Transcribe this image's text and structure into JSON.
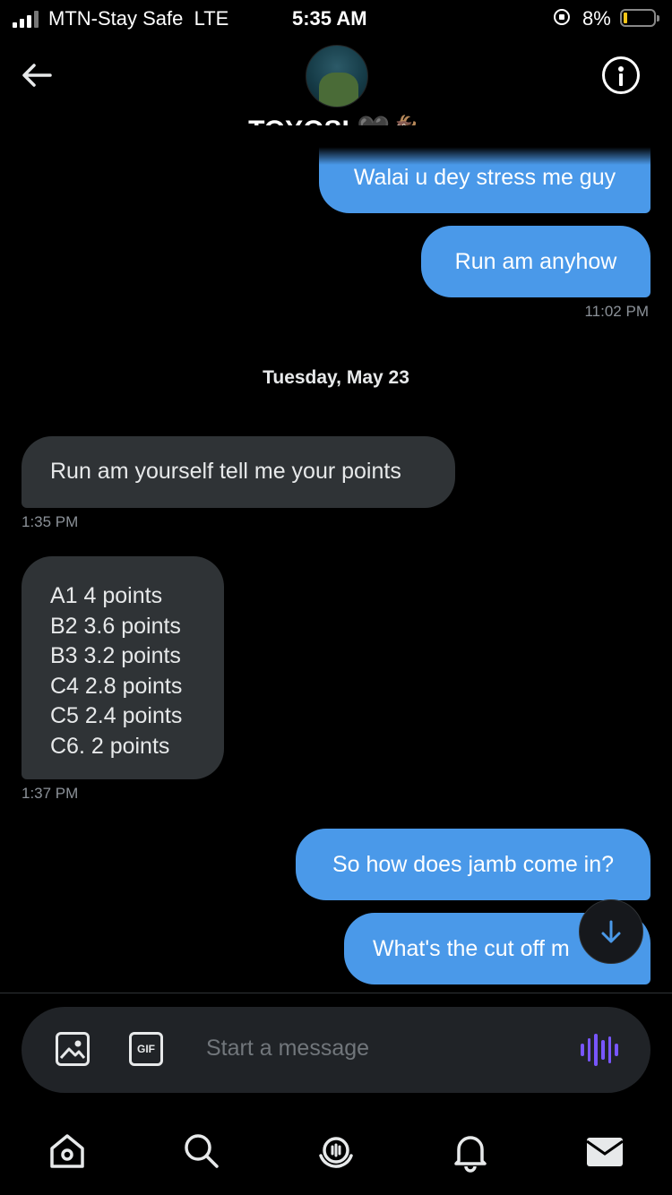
{
  "status_bar": {
    "carrier": "MTN-Stay Safe",
    "network": "LTE",
    "time": "5:35 AM",
    "battery": "8%",
    "battery_color": "#f5c518"
  },
  "header": {
    "name": "TOYOSI",
    "emoji": "🖤🐐",
    "back_icon": "arrow-left-icon",
    "info_icon": "info-icon"
  },
  "messages": {
    "m1": {
      "text": "Walai u dey stress me guy"
    },
    "m2": {
      "text": "Run am anyhow",
      "time": "11:02 PM"
    },
    "day_separator": "Tuesday, May 23",
    "m3": {
      "text": "Run am yourself tell me your points",
      "time": "1:35 PM"
    },
    "m4": {
      "text": "A1 4 points\nB2 3.6 points\nB3 3.2 points\nC4 2.8 points\nC5 2.4 points\nC6. 2 points",
      "time": "1:37 PM"
    },
    "m5": {
      "text": "So how does jamb come in?"
    },
    "m6": {
      "text": "What's the cut off m"
    }
  },
  "composer": {
    "placeholder": "Start a message",
    "gif_label": "GIF",
    "voice_color": "#7856ff"
  },
  "colors": {
    "outgoing_bubble": "#4a99e9",
    "incoming_bubble": "#2f3336",
    "background": "#000000"
  },
  "nav": [
    "home-icon",
    "search-icon",
    "spaces-icon",
    "notifications-icon",
    "messages-icon"
  ]
}
